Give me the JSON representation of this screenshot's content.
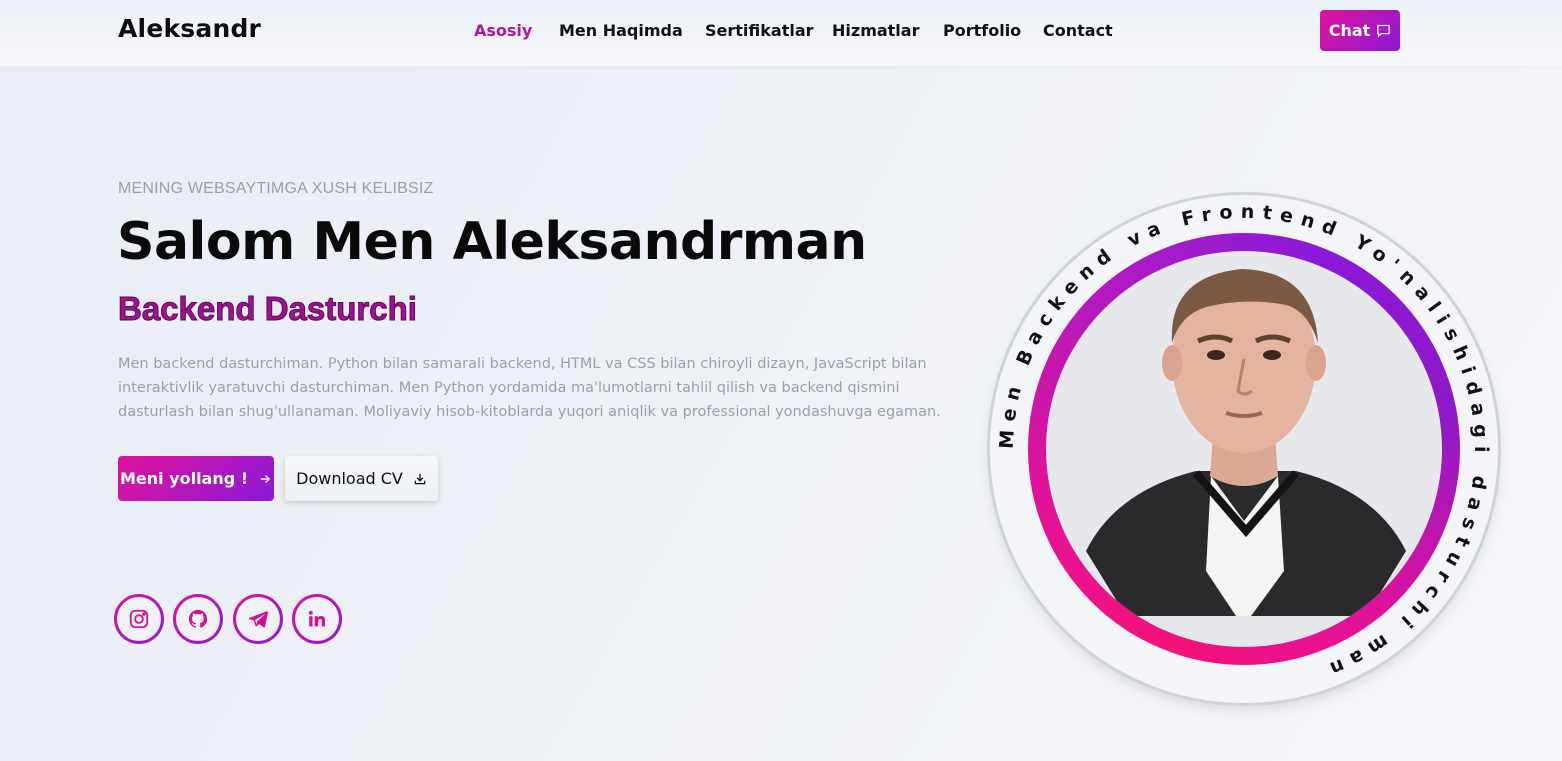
{
  "nav": {
    "logo": "Aleksandr",
    "links": [
      "Asosiy",
      "Men Haqimda",
      "Sertifikatlar",
      "Hizmatlar",
      "Portfolio",
      "Contact"
    ],
    "active": "Asosiy",
    "chat_label": "Chat"
  },
  "hero": {
    "welcome": "MENING WEBSAYTIMGA XUSH KELIBSIZ",
    "title": "Salom Men Aleksandrman",
    "role": "Backend Dasturchi",
    "description": "Men backend dasturchiman. Python bilan samarali backend, HTML va CSS bilan chiroyli dizayn, JavaScript bilan interaktivlik yaratuvchi dasturchiman. Men Python yordamida ma'lumotlarni tahlil qilish va backend qismini dasturlash bilan shug'ullanaman. Moliyaviy hisob-kitoblarda yuqori aniqlik va professional yondashuvga egaman.",
    "primary_button": "Meni yollang !",
    "secondary_button": "Download CV"
  },
  "social": [
    "instagram-icon",
    "github-icon",
    "telegram-icon",
    "linkedin-icon"
  ],
  "profile": {
    "circle_text": "Men Backend va Frontend Yo'nalishidagi dasturchi man"
  },
  "colors": {
    "accent_pink": "#e0129a",
    "accent_purple": "#8a19d8",
    "active_link": "#b1179a",
    "role_text": "#a0118e"
  }
}
